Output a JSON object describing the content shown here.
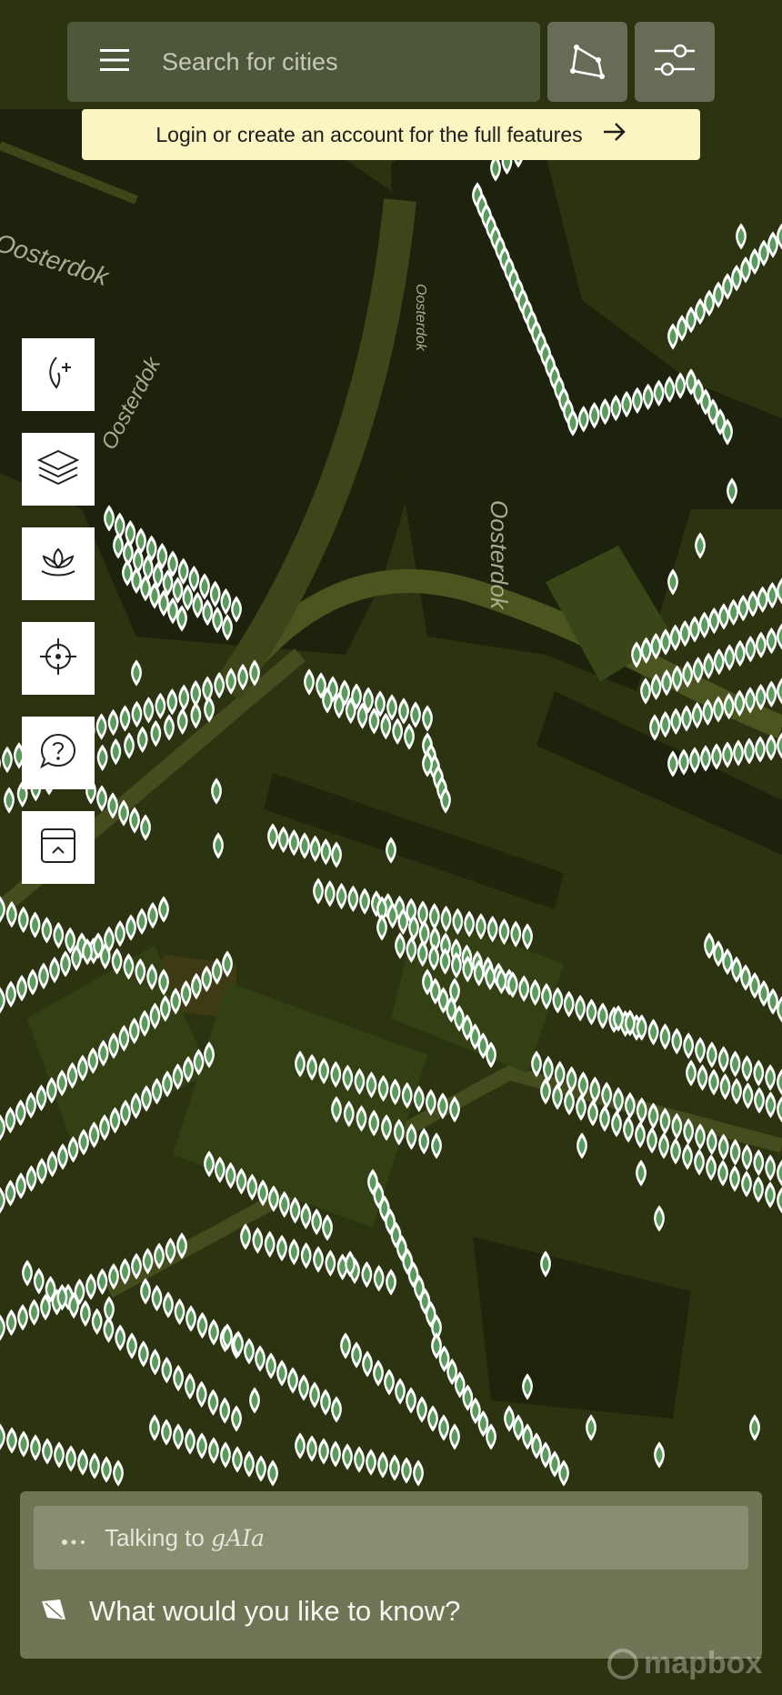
{
  "search": {
    "placeholder": "Search for cities"
  },
  "banner": {
    "text": "Login or create an account for the full features"
  },
  "map": {
    "water_labels": [
      "Oosterdok",
      "Oosterdok",
      "Oosterdok",
      "Oosterdok"
    ],
    "attribution": "mapbox"
  },
  "toolbar": {
    "menu_icon": "hamburger-icon",
    "draw_icon": "polygon-icon",
    "filter_icon": "sliders-icon"
  },
  "side_buttons": [
    {
      "icon": "add-leaf-icon"
    },
    {
      "icon": "layers-icon"
    },
    {
      "icon": "lotus-icon"
    },
    {
      "icon": "locate-crosshair-icon"
    },
    {
      "icon": "help-chat-icon"
    },
    {
      "icon": "panel-expand-icon"
    }
  ],
  "chat": {
    "status_prefix": "Talking to",
    "assistant_name": "gAIa",
    "input_placeholder": "What would you like to know?"
  },
  "colors": {
    "map_background": "#2b3310",
    "water": "#1c220b",
    "marker_fill": "#5a9a5c",
    "marker_stroke": "#ffffff",
    "banner": "#fbf5c1"
  }
}
